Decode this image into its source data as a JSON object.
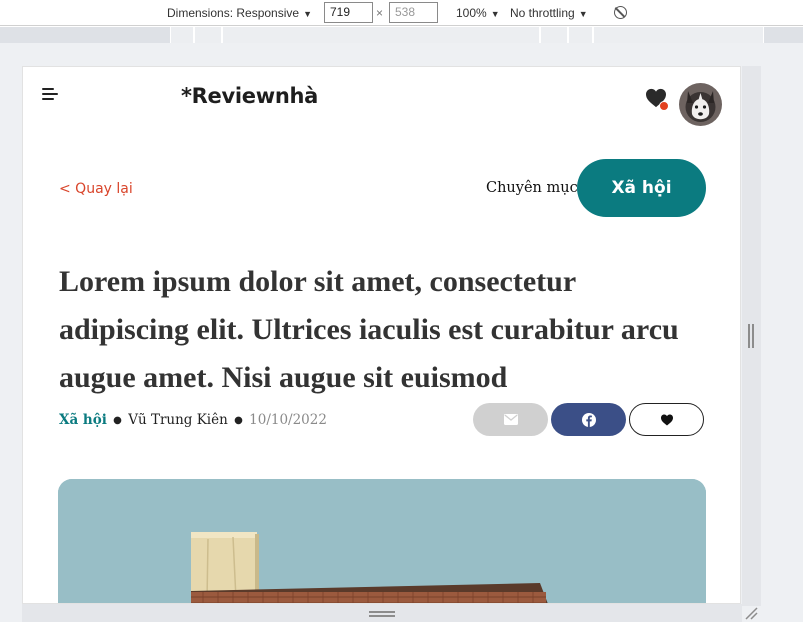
{
  "devtools": {
    "dimensions_label": "Dimensions: Responsive",
    "width_value": "719",
    "height_value": "538",
    "times_symbol": "×",
    "zoom_label": "100%",
    "throttling_label": "No throttling",
    "caret": "▼",
    "icons": [
      "caret-down-icon",
      "no-entry-icon",
      "resize-grip-icon",
      "corner-resize-icon"
    ]
  },
  "header": {
    "logo": "*Reviewnhà",
    "icons": [
      "hamburger-menu-icon",
      "heart-icon",
      "notification-dot",
      "avatar-husky"
    ],
    "notification_color": "#e3411f"
  },
  "nav": {
    "back_label": "< Quay lại",
    "category_label": "Chuyên mục:",
    "category_pill": "Xã hội"
  },
  "article": {
    "title": "Lorem ipsum dolor sit amet, consectetur adipiscing elit. Ultrices iaculis est curabitur arcu augue amet. Nisi augue sit euismod",
    "category": "Xã hội",
    "author": "Vũ Trung Kiên",
    "date": "10/10/2022",
    "bullet": "●",
    "share_icons": [
      "mail-icon",
      "facebook-icon",
      "heart-icon"
    ]
  },
  "colors": {
    "accent_teal": "#0b7b80",
    "back_link_red": "#d9452b",
    "facebook_blue": "#3b4f87",
    "mail_gray": "#d0d0d0",
    "title_text": "#333333"
  }
}
